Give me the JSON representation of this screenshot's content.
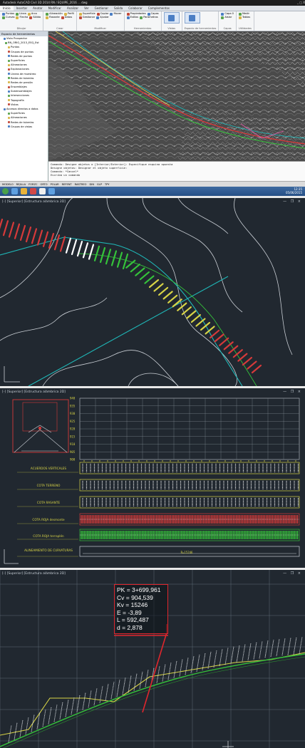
{
  "window": {
    "title": "Autodesk AutoCAD Civil 3D 2014   RN / EQUIPE_2016 ... dwg",
    "controls": "_ □ X"
  },
  "ribbon": {
    "tabs": [
      "Inicio",
      "Insertar",
      "Anotar",
      "Modificar",
      "Analizar",
      "Ver",
      "Gestionar",
      "Salida",
      "Colaborar",
      "Complementos"
    ],
    "active_tab_index": 0,
    "groups": [
      {
        "label": "Dibujar",
        "rows": [
          [
            "Puntos",
            "Línea",
            "Arco"
          ],
          [
            "Curvas",
            "Flecha",
            "Sólido"
          ]
        ]
      },
      {
        "label": "Crear",
        "rows": [
          [
            "Alineación",
            "Perfil"
          ],
          [
            "Rasante",
            "Datos"
          ]
        ]
      },
      {
        "label": "Modificar",
        "rows": [
          [
            "Superficie",
            "Copiar",
            "Mover"
          ],
          [
            "Gestionar",
            "Ajustar"
          ]
        ]
      },
      {
        "label": "Herramientas",
        "rows": [
          [
            "Propiedades",
            "Capas"
          ],
          [
            "Estilos",
            "Parámetros"
          ]
        ]
      },
      {
        "label": "Capas",
        "rows": [
          [
            "Capa 0"
          ],
          [
            "Aislar"
          ]
        ]
      },
      {
        "label": "Utilidades",
        "rows": [
          [
            "Medir"
          ],
          [
            "Tablas"
          ]
        ]
      }
    ],
    "big_buttons": [
      "Vistas",
      "Espacio de herramientas"
    ]
  },
  "toolspace": {
    "header": "Espacio de herramientas",
    "items": [
      "Vista Prospector",
      "RN_ORIG_2013_ESQ_Est",
      "Puntos",
      "Grupos de puntos",
      "Redes de puntos",
      "Superficies",
      "Alineaciones",
      "Explanaciones",
      "Líneas de muestreo",
      "Redes de tuberías",
      "Redes de presión",
      "Ensamblajes",
      "Subensamblajes",
      "Intersecciones",
      "Topografía",
      "Vistas",
      "Accesos directos a datos",
      "Superficies",
      "Alineaciones",
      "Redes de tuberías",
      "Grupos de vistas"
    ]
  },
  "command_line": {
    "lines": [
      "Comando: Designe objetos o [Interior/Exterior]: Especifique esquina opuesta",
      "Designe objetos: Designar el objeto superficie:",
      "Comando: *Cancel*",
      "Escriba un comando"
    ]
  },
  "statusbar": {
    "items": [
      "MODELO",
      "REJILLA",
      "FORZC",
      "ORTO",
      "POLAR",
      "REFENT",
      "RASTREO",
      "DIN",
      "GLP",
      "TPY"
    ]
  },
  "taskbar": {
    "time": "12:35",
    "date": "05/06/2015"
  },
  "viewport2": {
    "label": "[-] [Superior] [Estructura alámbrica 2D]",
    "controls": "— ❐ ×"
  },
  "viewport3": {
    "label": "[-] [Superior] [Estructura alámbrica 2D]",
    "controls": "— ❐ ×",
    "bands": [
      {
        "label": "ACUERDOS VERTICALES"
      },
      {
        "label": "COTA TERRENO"
      },
      {
        "label": "COTA RASANTE"
      },
      {
        "label": "COTA ROJA desmonte"
      },
      {
        "label": "COTA ROJA terraplén"
      },
      {
        "label": "ALINEAMIENTO DE CURVATURAS"
      }
    ],
    "elevations": [
      "900",
      "905",
      "910",
      "915",
      "920",
      "925",
      "930",
      "935",
      "940"
    ],
    "vertical_curve_text": "R=15246"
  },
  "viewport4": {
    "label": "[-] [Superior] [Estructura alámbrica 2D]",
    "controls": "— ❐ ×",
    "tooltip": {
      "pk": "PK = 3+699,961",
      "cv": "Cv  = 904,539",
      "kv": "Kv  = 15246",
      "e": "E    = -3,89",
      "l": "L     = 592,487",
      "d": "d     = 2,878"
    }
  },
  "colors": {
    "background_dark": "#212830",
    "terrain_line": "#c9ced4",
    "alignment_cyan": "#1fb7b7",
    "cut_red": "#d53a3a",
    "fill_green": "#35c23a",
    "grade_yellow": "#d7d346",
    "tooltip_border": "#e0262d"
  }
}
